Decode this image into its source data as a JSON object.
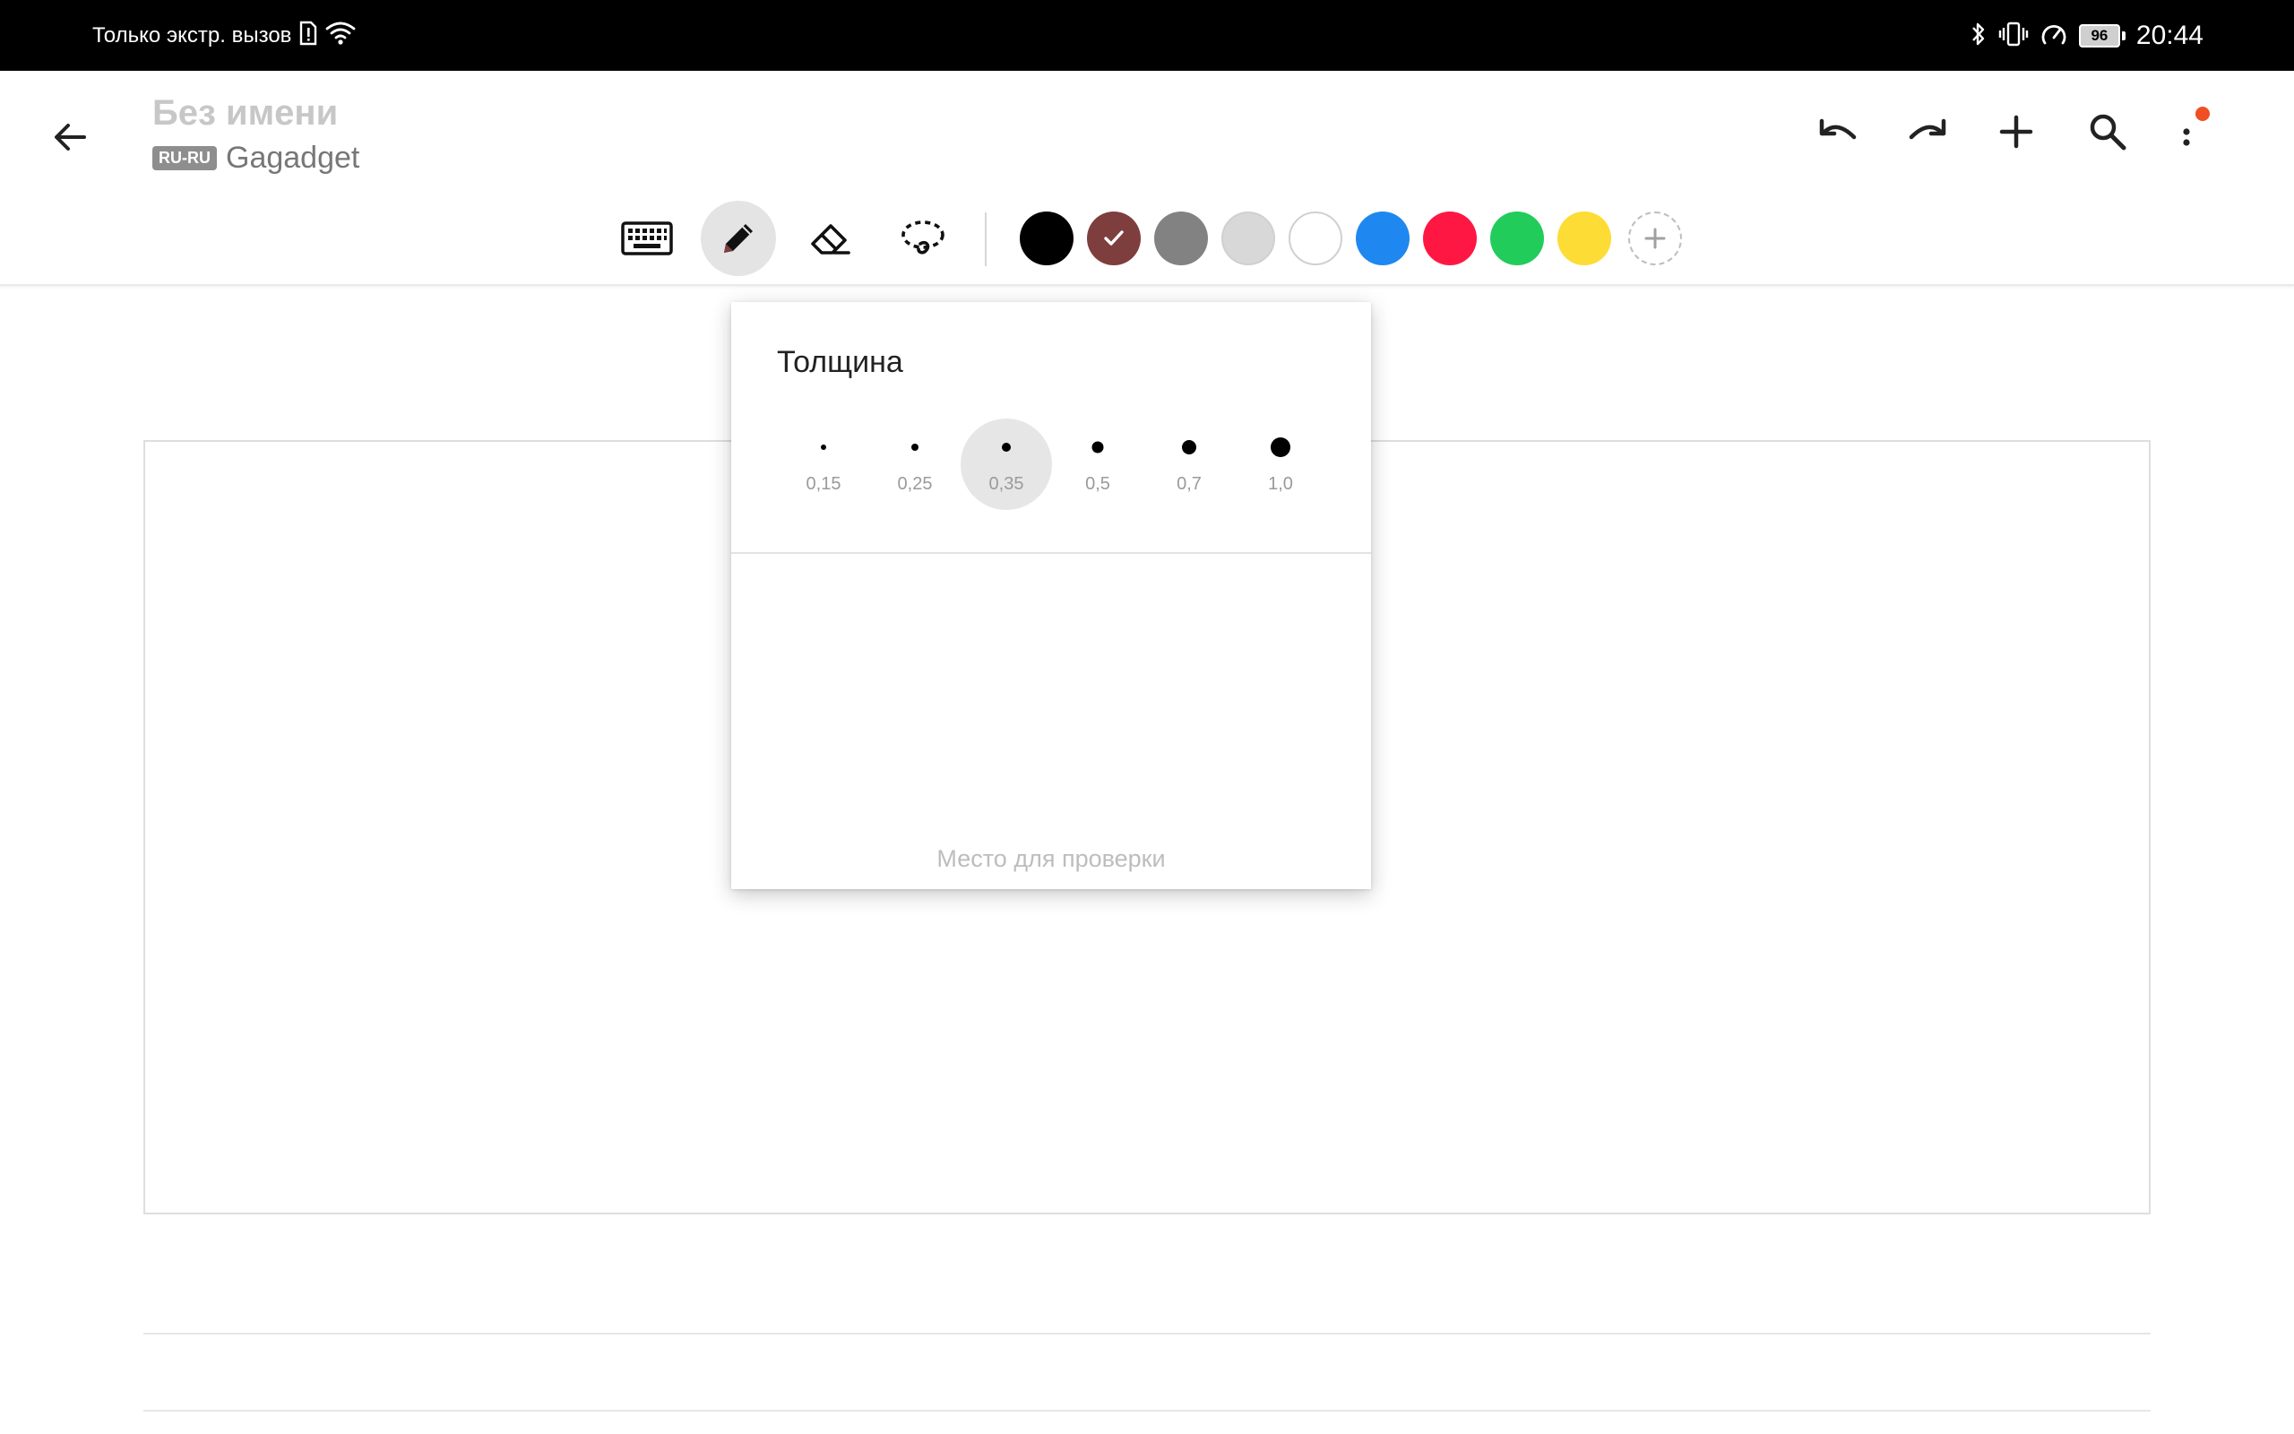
{
  "status_bar": {
    "carrier_text": "Только экстр. вызов",
    "battery_level": "96",
    "time": "20:44",
    "icons": [
      "sim-alert-icon",
      "wifi-icon",
      "bluetooth-icon",
      "vibrate-icon",
      "speed-icon",
      "battery-icon"
    ]
  },
  "app_bar": {
    "title": "Без имени",
    "language_badge": "RU-RU",
    "subtitle": "Gagadget",
    "actions": [
      "undo-icon",
      "redo-icon",
      "add-icon",
      "search-icon",
      "more-icon"
    ],
    "notification_dot_color": "#f04e23"
  },
  "toolbar": {
    "tools": [
      {
        "name": "keyboard",
        "icon": "keyboard-icon",
        "active": false
      },
      {
        "name": "pen",
        "icon": "pen-icon",
        "active": true
      },
      {
        "name": "eraser",
        "icon": "eraser-icon",
        "active": false
      },
      {
        "name": "lasso",
        "icon": "lasso-icon",
        "active": false
      }
    ],
    "colors": [
      {
        "hex": "#000000",
        "selected": false
      },
      {
        "hex": "#7f3e3e",
        "selected": true
      },
      {
        "hex": "#828282",
        "selected": false
      },
      {
        "hex": "#d8d8d8",
        "selected": false
      },
      {
        "hex": "#ffffff",
        "selected": false
      },
      {
        "hex": "#1e88f0",
        "selected": false
      },
      {
        "hex": "#ff1744",
        "selected": false
      },
      {
        "hex": "#22cc5b",
        "selected": false
      },
      {
        "hex": "#fddc35",
        "selected": false
      }
    ],
    "add_color_icon": "plus-icon"
  },
  "thickness_popup": {
    "title": "Толщина",
    "options": [
      {
        "label": "0,15",
        "selected": false
      },
      {
        "label": "0,25",
        "selected": false
      },
      {
        "label": "0,35",
        "selected": true
      },
      {
        "label": "0,5",
        "selected": false
      },
      {
        "label": "0,7",
        "selected": false
      },
      {
        "label": "1,0",
        "selected": false
      }
    ],
    "preview_hint": "Место для проверки"
  }
}
